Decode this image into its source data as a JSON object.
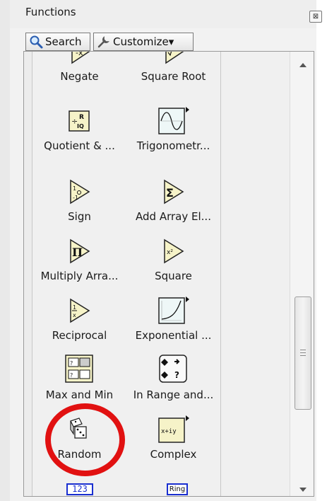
{
  "window": {
    "title": "Functions",
    "close_glyph": "⊠"
  },
  "toolbar": {
    "search_label": "Search",
    "customize_label": "Customize▾"
  },
  "items": [
    {
      "label": "Negate",
      "icon": "negate-icon"
    },
    {
      "label": "Square Root",
      "icon": "square-root-icon"
    },
    {
      "label": "Quotient & ...",
      "icon": "quotient-remainder-icon"
    },
    {
      "label": "Trigonometr...",
      "icon": "trigonometric-icon"
    },
    {
      "label": "Sign",
      "icon": "sign-icon"
    },
    {
      "label": "Add Array El...",
      "icon": "add-array-elements-icon"
    },
    {
      "label": "Multiply Arra...",
      "icon": "multiply-array-icon"
    },
    {
      "label": "Square",
      "icon": "square-icon"
    },
    {
      "label": "Reciprocal",
      "icon": "reciprocal-icon"
    },
    {
      "label": "Exponential ...",
      "icon": "exponential-icon"
    },
    {
      "label": "Max and Min",
      "icon": "max-min-icon"
    },
    {
      "label": "In Range and...",
      "icon": "in-range-icon"
    },
    {
      "label": "Random",
      "icon": "dice-icon"
    },
    {
      "label": "Complex",
      "icon": "complex-icon"
    }
  ],
  "partial_row": {
    "left_text": "123",
    "right_text": "Ring"
  },
  "highlight_color": "#e11111"
}
